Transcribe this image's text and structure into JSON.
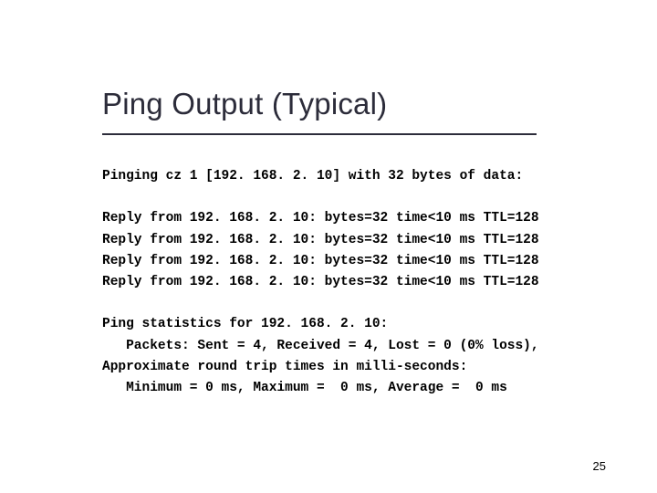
{
  "title": "Ping Output (Typical)",
  "ping_header": "Pinging cz 1 [192. 168. 2. 10] with 32 bytes of data:",
  "replies": [
    "Reply from 192. 168. 2. 10: bytes=32 time<10 ms TTL=128",
    "Reply from 192. 168. 2. 10: bytes=32 time<10 ms TTL=128",
    "Reply from 192. 168. 2. 10: bytes=32 time<10 ms TTL=128",
    "Reply from 192. 168. 2. 10: bytes=32 time<10 ms TTL=128"
  ],
  "stats_header": "Ping statistics for 192. 168. 2. 10:",
  "packets_line": "   Packets: Sent = 4, Received = 4, Lost = 0 (0% loss),",
  "rtt_header": "Approximate round trip times in milli-seconds:",
  "rtt_line": "   Minimum = 0 ms, Maximum =  0 ms, Average =  0 ms",
  "page_number": "25"
}
